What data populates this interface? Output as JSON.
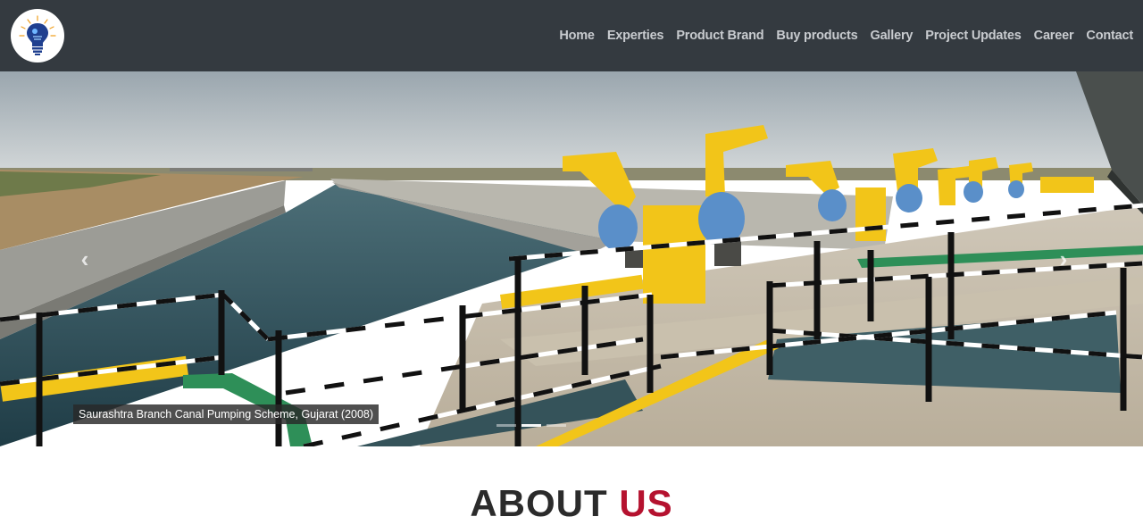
{
  "header": {
    "logo_icon": "lightbulb-logo-icon",
    "nav": [
      {
        "label": "Home"
      },
      {
        "label": "Experties"
      },
      {
        "label": "Product Brand"
      },
      {
        "label": "Buy products"
      },
      {
        "label": "Gallery"
      },
      {
        "label": "Project Updates"
      },
      {
        "label": "Career"
      },
      {
        "label": "Contact"
      }
    ],
    "background_color": "#343a40"
  },
  "carousel": {
    "caption": "Saurashtra Branch Canal Pumping Scheme, Gujarat (2008)",
    "prev_icon": "chevron-left-icon",
    "next_icon": "chevron-right-icon",
    "slide_count": 3,
    "active_slide": 1
  },
  "about": {
    "title_part1": "ABOUT",
    "title_part2": "US",
    "accent_color": "#b5122f"
  }
}
